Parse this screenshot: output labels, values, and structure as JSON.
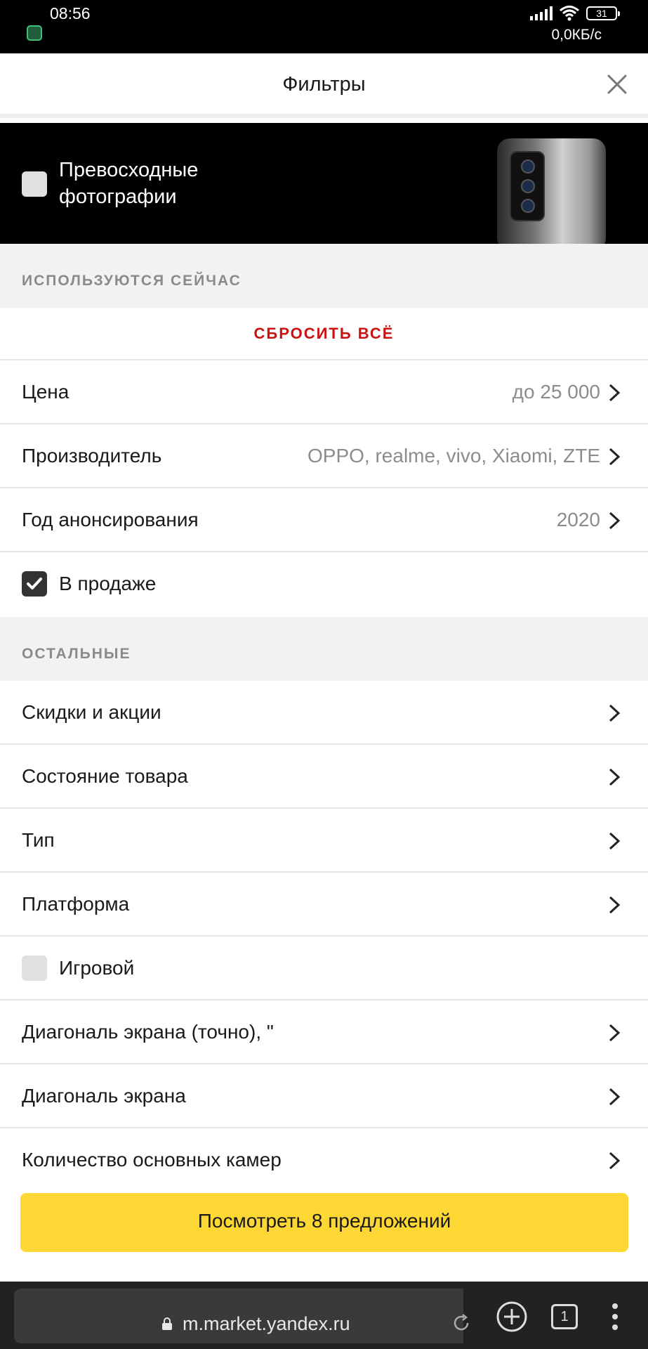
{
  "status_bar": {
    "time": "08:56",
    "battery": "31",
    "net_speed": "0,0КБ/с"
  },
  "header": {
    "title": "Фильтры",
    "close_icon": "close-icon"
  },
  "promo": {
    "label": "Превосходные фотографии",
    "checked": false
  },
  "section_active": {
    "title": "ИСПОЛЬЗУЮТСЯ СЕЙЧАС",
    "reset_label": "СБРОСИТЬ ВСЁ",
    "rows": [
      {
        "label": "Цена",
        "value": "до 25 000"
      },
      {
        "label": "Производитель",
        "value": "OPPO, realme, vivo, Xiaomi, ZTE"
      },
      {
        "label": "Год анонсирования",
        "value": "2020"
      },
      {
        "label": "В продаже",
        "checked": true
      }
    ]
  },
  "section_other": {
    "title": "ОСТАЛЬНЫЕ",
    "rows": [
      {
        "label": "Скидки и акции"
      },
      {
        "label": "Состояние товара"
      },
      {
        "label": "Тип"
      },
      {
        "label": "Платформа"
      },
      {
        "label": "Игровой",
        "checked": false
      },
      {
        "label": "Диагональ экрана (точно), \""
      },
      {
        "label": "Диагональ экрана"
      },
      {
        "label": "Количество основных камер"
      }
    ]
  },
  "cta": {
    "label": "Посмотреть 8 предложений",
    "color": "#fdd835"
  },
  "browser": {
    "url": "m.market.yandex.ru",
    "tabs_count": "1"
  },
  "colors": {
    "accent_red": "#cc1111",
    "muted_text": "#8c8c8c"
  }
}
